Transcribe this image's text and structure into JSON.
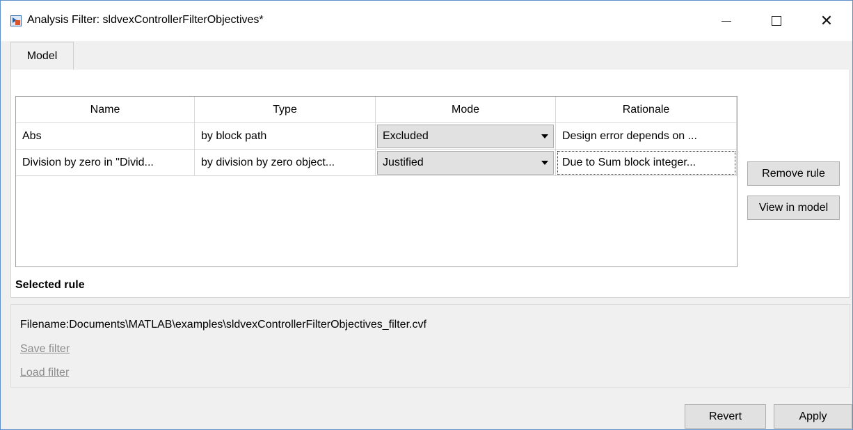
{
  "window": {
    "title": "Analysis Filter: sldvexControllerFilterObjectives*"
  },
  "tabs": [
    {
      "label": "Model"
    }
  ],
  "table": {
    "headers": [
      "Name",
      "Type",
      "Mode",
      "Rationale"
    ],
    "rows": [
      {
        "name": "Abs",
        "type": "by block path",
        "mode": "Excluded",
        "rationale": "Design error depends on ..."
      },
      {
        "name": "Division by zero in \"Divid...",
        "type": "by division by zero object...",
        "mode": "Justified",
        "rationale": "Due to Sum block integer..."
      }
    ]
  },
  "side_buttons": {
    "remove_rule": "Remove rule",
    "view_in_model": "View in model"
  },
  "selected_rule_label": "Selected rule",
  "file": {
    "filename_text": "Filename:Documents\\MATLAB\\examples\\sldvexControllerFilterObjectives_filter.cvf",
    "save_filter": "Save filter",
    "load_filter": "Load filter"
  },
  "footer": {
    "revert": "Revert",
    "apply": "Apply"
  },
  "icons": {
    "window": "simulink-app-icon",
    "minimize": "minimize-icon",
    "maximize": "maximize-icon",
    "close": "close-icon",
    "dropdown": "chevron-down-icon"
  }
}
